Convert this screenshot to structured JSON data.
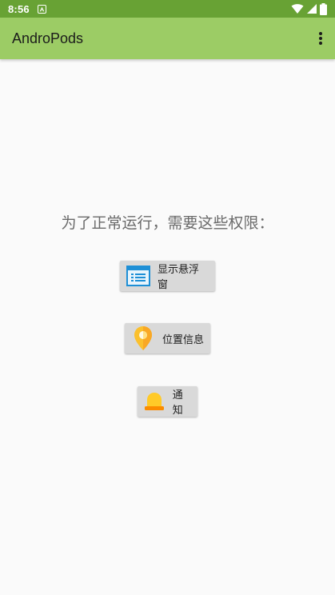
{
  "status_bar": {
    "time": "8:56",
    "notification_icon": "android-a-icon",
    "icons": [
      "wifi-icon",
      "signal-icon",
      "battery-icon"
    ]
  },
  "app_bar": {
    "title": "AndroPods",
    "overflow_icon": "more-vert-icon"
  },
  "main": {
    "prompt": "为了正常运行，需要这些权限：",
    "permissions": [
      {
        "label": "显示悬浮窗",
        "icon": "window-list-icon"
      },
      {
        "label": "位置信息",
        "icon": "location-pin-icon"
      },
      {
        "label": "通知",
        "icon": "bell-icon"
      }
    ]
  },
  "colors": {
    "status_bar": "#68a234",
    "app_bar": "#9ccc65",
    "background": "#fafafa",
    "button": "#d9d9d9",
    "window_icon_blue": "#1e8fd6",
    "pin_yellow": "#fbc02d",
    "bell_yellow": "#ffca28",
    "bell_orange": "#fb8c00"
  }
}
